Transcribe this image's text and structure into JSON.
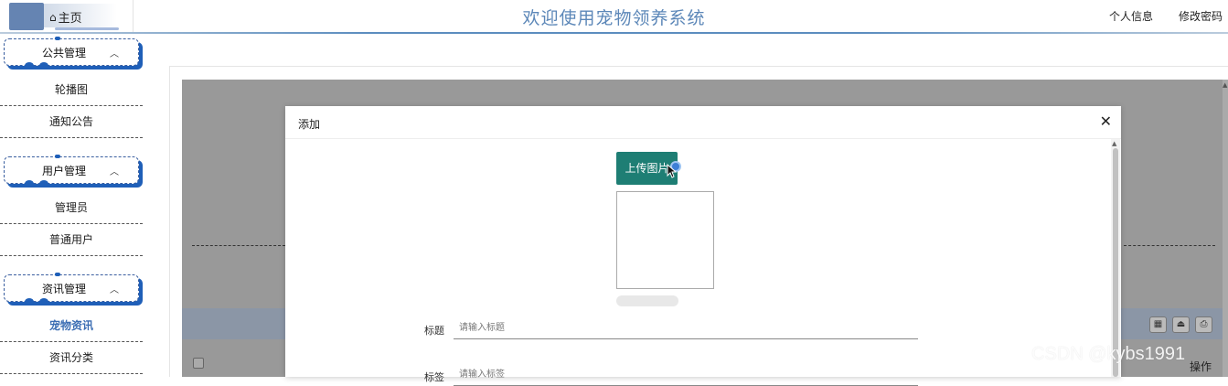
{
  "header": {
    "home_label": "主页",
    "title": "欢迎使用宠物领养系统",
    "profile_link": "个人信息",
    "password_link": "修改密码"
  },
  "sidebar": {
    "groups": [
      {
        "label": "公共管理",
        "items": [
          "轮播图",
          "通知公告"
        ]
      },
      {
        "label": "用户管理",
        "items": [
          "管理员",
          "普通用户"
        ]
      },
      {
        "label": "资讯管理",
        "items": [
          "宠物资讯",
          "资讯分类"
        ]
      }
    ],
    "active_item": "宠物资讯",
    "accent_color": "#1f5fb8"
  },
  "table": {
    "operation_header": "操作"
  },
  "dialog": {
    "title": "添加",
    "upload_button": "上传图片",
    "fields": [
      {
        "label": "标题",
        "placeholder": "请输入标题"
      },
      {
        "label": "标签",
        "placeholder": "请输入标签"
      }
    ],
    "upload_color": "#1e7e74"
  },
  "watermark": "CSDN @kybs1991"
}
